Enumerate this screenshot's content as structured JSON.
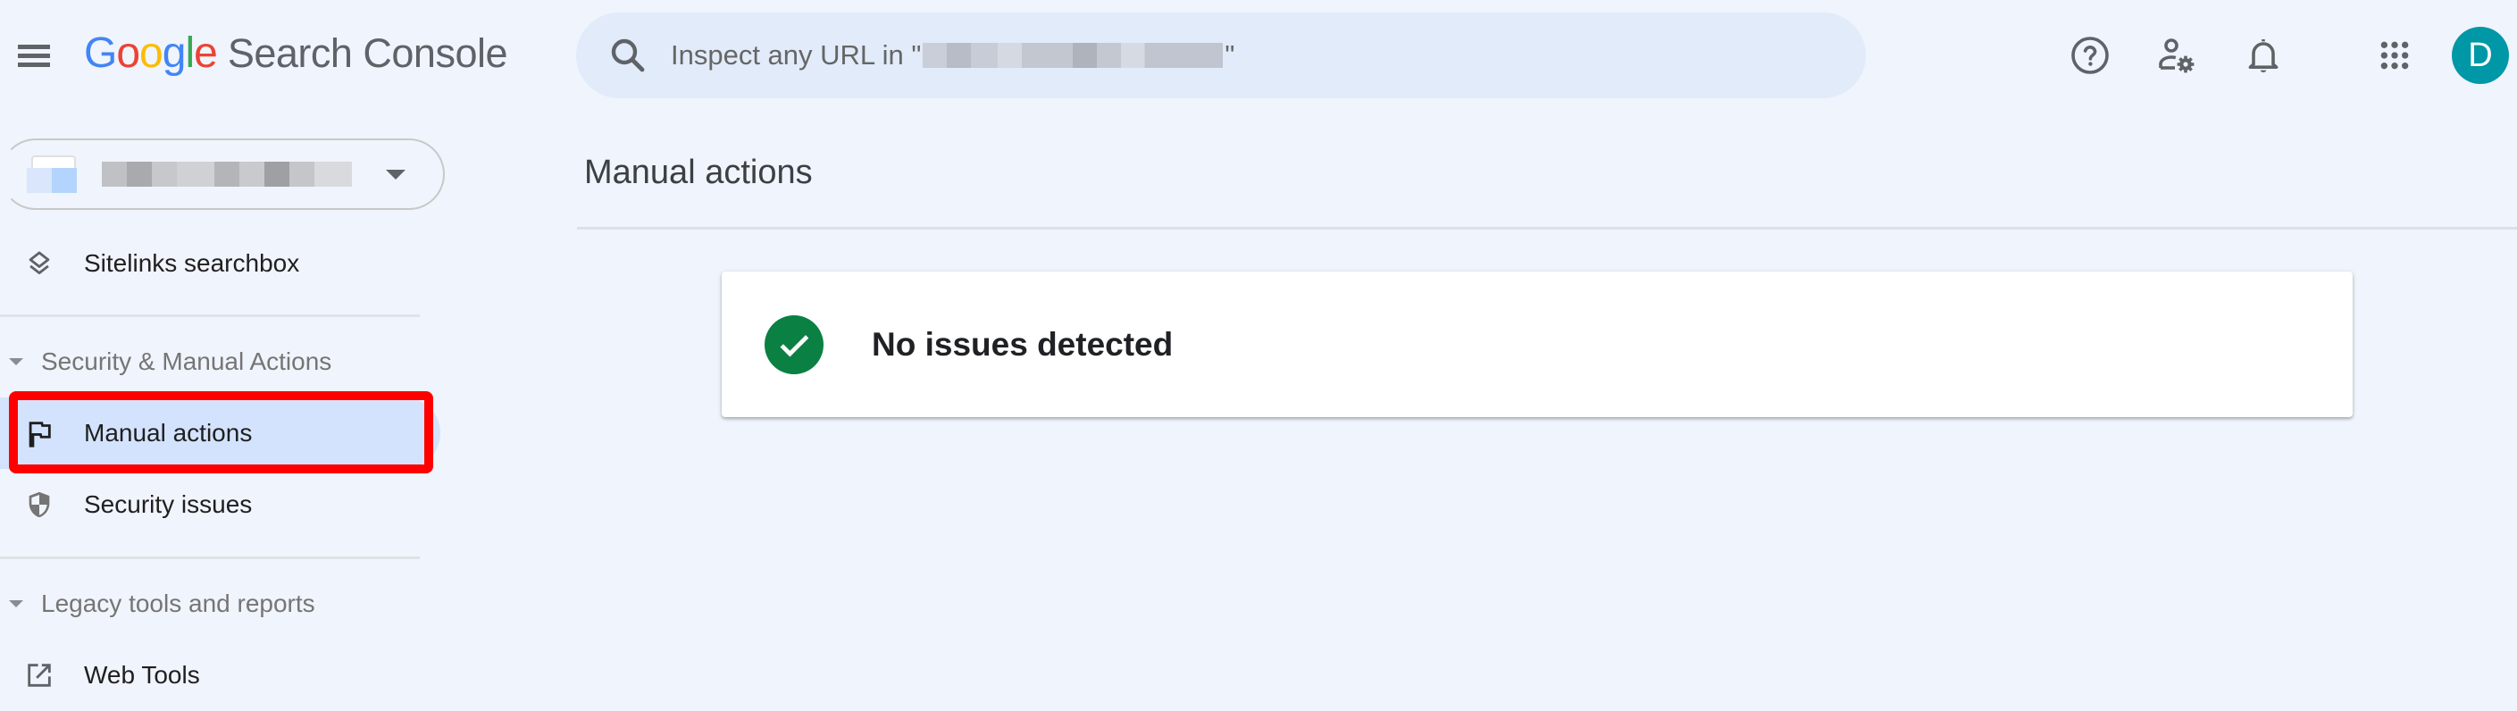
{
  "header": {
    "menu_icon": "hamburger-menu-icon",
    "logo": {
      "letters": [
        {
          "char": "G",
          "color": "#4285f4"
        },
        {
          "char": "o",
          "color": "#ea4335"
        },
        {
          "char": "o",
          "color": "#fbbc05"
        },
        {
          "char": "g",
          "color": "#4285f4"
        },
        {
          "char": "l",
          "color": "#34a853"
        },
        {
          "char": "e",
          "color": "#ea4335"
        }
      ],
      "product": "Search Console"
    },
    "search": {
      "icon": "search-icon",
      "placeholder_prefix": "Inspect any URL in \"",
      "placeholder_suffix": "\"",
      "property_redacted": true
    },
    "icons": [
      "help-icon",
      "user-settings-icon",
      "notifications-bell-icon",
      "apps-grid-icon"
    ],
    "avatar": {
      "initial": "D",
      "color": "#0097a7"
    }
  },
  "sidebar": {
    "property_selector": {
      "name_redacted": true,
      "icon": "chevron-down-icon"
    },
    "items_top": [
      {
        "label": "Sitelinks searchbox",
        "icon": "layers-icon"
      }
    ],
    "sections": [
      {
        "label": "Security & Manual Actions",
        "items": [
          {
            "label": "Manual actions",
            "icon": "flag-icon",
            "selected": true
          },
          {
            "label": "Security issues",
            "icon": "shield-icon",
            "selected": false
          }
        ]
      },
      {
        "label": "Legacy tools and reports",
        "items": [
          {
            "label": "Web Tools",
            "icon": "open-in-new-icon",
            "selected": false
          }
        ]
      }
    ]
  },
  "main": {
    "title": "Manual actions",
    "status_card": {
      "icon": "check-circle-icon",
      "text": "No issues detected",
      "color": "#0b8043"
    }
  },
  "annotation": {
    "target": "Manual actions",
    "color": "#ff0000"
  }
}
